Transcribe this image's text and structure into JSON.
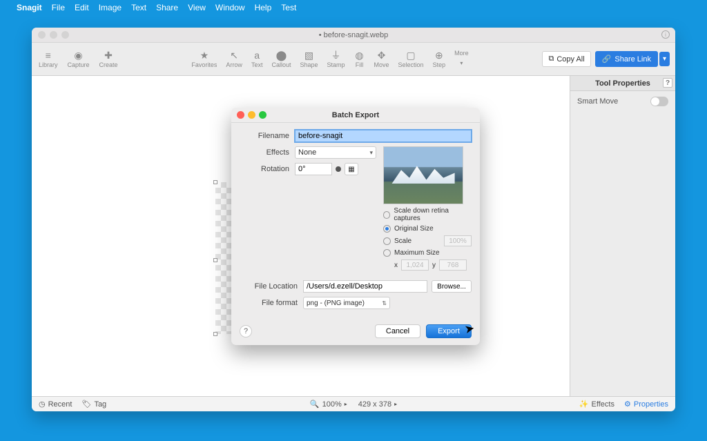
{
  "menubar": {
    "appname": "Snagit",
    "items": [
      "File",
      "Edit",
      "Image",
      "Text",
      "Share",
      "View",
      "Window",
      "Help",
      "Test"
    ]
  },
  "window": {
    "title": "• before-snagit.webp"
  },
  "toolbar": {
    "left": [
      {
        "id": "library",
        "label": "Library",
        "glyph": "≡"
      },
      {
        "id": "capture",
        "label": "Capture",
        "glyph": "◉"
      },
      {
        "id": "create",
        "label": "Create",
        "glyph": "✚"
      }
    ],
    "center": [
      {
        "id": "favorites",
        "label": "Favorites",
        "glyph": "★"
      },
      {
        "id": "arrow",
        "label": "Arrow",
        "glyph": "↖"
      },
      {
        "id": "text",
        "label": "Text",
        "glyph": "a"
      },
      {
        "id": "callout",
        "label": "Callout",
        "glyph": "⬤"
      },
      {
        "id": "shape",
        "label": "Shape",
        "glyph": "▧"
      },
      {
        "id": "stamp",
        "label": "Stamp",
        "glyph": "⏚"
      },
      {
        "id": "fill",
        "label": "Fill",
        "glyph": "◍"
      },
      {
        "id": "move",
        "label": "Move",
        "glyph": "✥"
      },
      {
        "id": "selection",
        "label": "Selection",
        "glyph": "▢"
      },
      {
        "id": "step",
        "label": "Step",
        "glyph": "⊕"
      }
    ],
    "more": "More",
    "copyall": "Copy All",
    "share": "Share Link"
  },
  "rightPanel": {
    "title": "Tool Properties",
    "smartmove": "Smart Move"
  },
  "statusbar": {
    "recent": "Recent",
    "tag": "Tag",
    "zoom": "100% ",
    "dims": "429 x 378 ",
    "effects": "Effects",
    "properties": "Properties"
  },
  "dialog": {
    "title": "Batch Export",
    "labels": {
      "filename": "Filename",
      "effects": "Effects",
      "rotation": "Rotation",
      "filelocation": "File Location",
      "fileformat": "File format"
    },
    "values": {
      "filename": "before-snagit",
      "effects": "None",
      "rotation": "0°",
      "filelocation": "/Users/d.ezell/Desktop",
      "fileformat": "png - (PNG image)"
    },
    "sizeOptions": {
      "retina": "Scale down retina captures",
      "original": "Original Size",
      "scale": "Scale",
      "scaleVal": "100%",
      "maxsize": "Maximum Size",
      "x": "x",
      "xval": "1,024",
      "y": "y",
      "yval": "768"
    },
    "buttons": {
      "browse": "Browse...",
      "cancel": "Cancel",
      "export": "Export"
    }
  }
}
